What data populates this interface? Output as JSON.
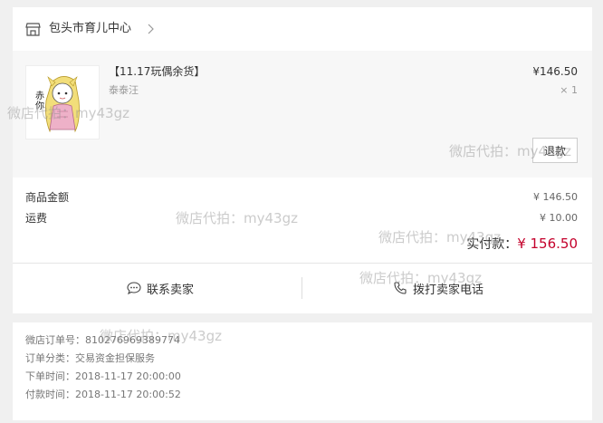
{
  "shop": {
    "name": "包头市育儿中心"
  },
  "product": {
    "title": "【11.17玩偶余货】",
    "variant": "泰泰汪",
    "price": "¥146.50",
    "quantity": "× 1",
    "image_text": "赤你",
    "refund_label": "退款"
  },
  "summary": {
    "goods_label": "商品金额",
    "goods_value": "¥ 146.50",
    "shipping_label": "运费",
    "shipping_value": "¥ 10.00",
    "paid_label": "实付款：",
    "paid_value": "¥ 156.50"
  },
  "actions": {
    "contact_label": "联系卖家",
    "call_label": "拨打卖家电话"
  },
  "order_info": [
    "微店订单号：810276969389774",
    "订单分类：交易资金担保服务",
    "下单时间：2018-11-17 20:00:00",
    "付款时间：2018-11-17 20:00:52"
  ],
  "watermark": "微店代拍：my43gz",
  "colors": {
    "accent_red": "#c4002b",
    "background": "#f0f0f0"
  }
}
